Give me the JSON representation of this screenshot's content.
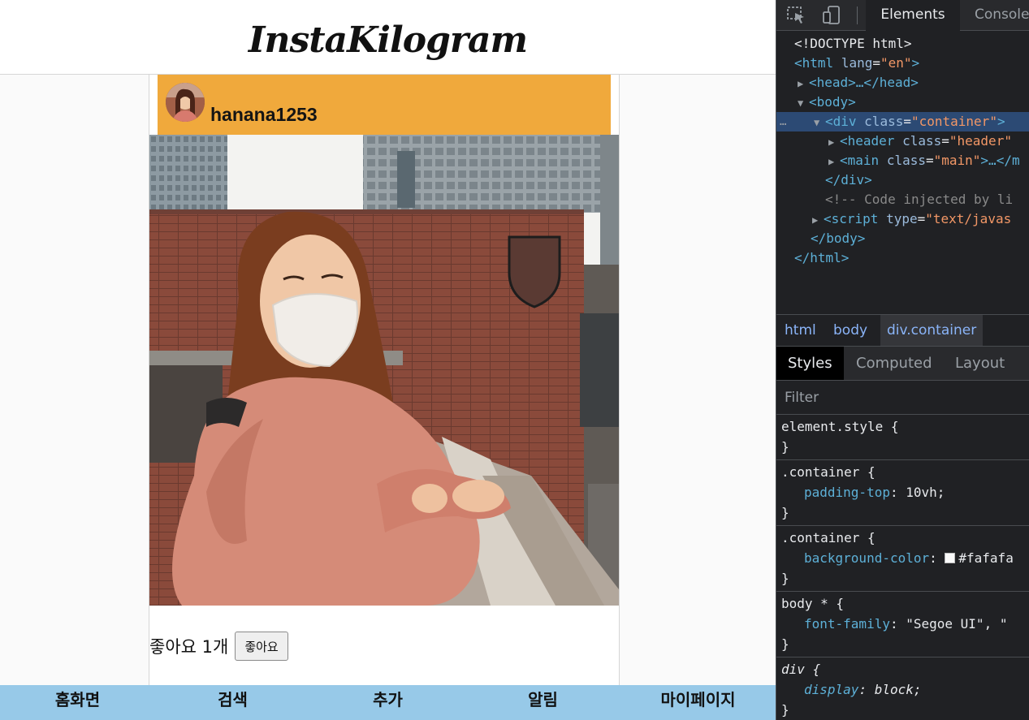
{
  "site": {
    "logo": "InstaKilogram"
  },
  "post": {
    "username": "hanana1253",
    "likes_text": "좋아요 1개",
    "like_button": "좋아요"
  },
  "bottom_nav": [
    {
      "label": "홈화면"
    },
    {
      "label": "검색"
    },
    {
      "label": "추가"
    },
    {
      "label": "알림"
    },
    {
      "label": "마이페이지"
    }
  ],
  "devtools": {
    "tabs": [
      {
        "label": "Elements",
        "active": true
      },
      {
        "label": "Console",
        "active": false
      }
    ],
    "dom_tree": {
      "doctype": "<!DOCTYPE html>",
      "html_open_tag": "<html",
      "lang_attr": "lang",
      "lang_val": "\"en\"",
      "head_text": "<head>…</head>",
      "body_open": "<body>",
      "container_tag": "<div",
      "container_attr": "class",
      "container_val": "\"container\"",
      "container_end": ">",
      "header_tag": "<header",
      "header_attr": "class",
      "header_val": "\"header\"",
      "main_tag": "<main",
      "main_attr": "class",
      "main_val": "\"main\"",
      "main_rest": ">…</m",
      "div_close": "</div>",
      "comment": "<!-- Code injected by li",
      "script_tag": "<script",
      "script_attr": "type",
      "script_val": "\"text/javas",
      "body_close": "</body>",
      "html_close": "</html>"
    },
    "breadcrumbs": [
      {
        "label": "html"
      },
      {
        "label": "body"
      },
      {
        "label": "div.container"
      }
    ],
    "style_tabs": [
      {
        "label": "Styles"
      },
      {
        "label": "Computed"
      },
      {
        "label": "Layout"
      }
    ],
    "filter_placeholder": "Filter",
    "rules": {
      "element_style": "element.style {",
      "close_brace": "}",
      "container_selector": ".container {",
      "padding_top_name": "padding-top",
      "padding_top_value": "10vh;",
      "bg_name": "background-color",
      "bg_value": "#fafafa",
      "body_selector": "body * {",
      "font_family_name": "font-family",
      "font_family_value": "\"Segoe UI\", \"",
      "div_selector": "div {",
      "display_name": "display",
      "display_value": "block;"
    }
  },
  "colors": {
    "post_header": "#f0a93c",
    "bottom_nav": "#97c9e8",
    "page_background": "#fafafa",
    "devtools_background": "#202124"
  }
}
